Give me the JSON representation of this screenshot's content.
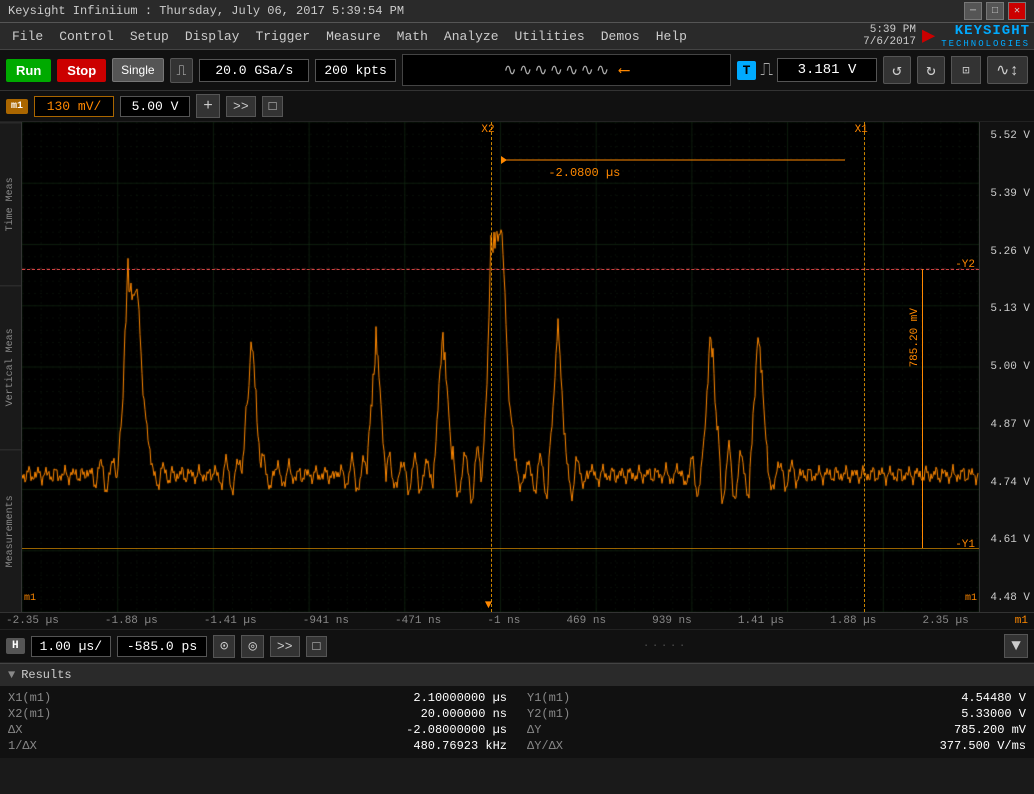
{
  "titleBar": {
    "text": "Keysight Infiniium : Thursday, July 06, 2017  5:39:54 PM",
    "controls": [
      "minimize",
      "restore",
      "close"
    ]
  },
  "logo": {
    "time": "5:39 PM",
    "date": "7/6/2017",
    "brand": "KEYSIGHT",
    "sub": "TECHNOLOGIES"
  },
  "menu": {
    "items": [
      "File",
      "Control",
      "Setup",
      "Display",
      "Trigger",
      "Measure",
      "Math",
      "Analyze",
      "Utilities",
      "Demos",
      "Help"
    ]
  },
  "toolbar": {
    "run_label": "Run",
    "stop_label": "Stop",
    "single_label": "Single",
    "sample_rate": "20.0 GSa/s",
    "mem_depth": "200 kpts",
    "trig_T": "T",
    "trig_value": "3.181 V",
    "wave_symbol": "∿∿∿∿∿∿∿"
  },
  "channel": {
    "badge": "m1",
    "vdiv": "130 mV/",
    "offset": "5.00 V",
    "plus": "+",
    "arrows": ">>",
    "ref": "□"
  },
  "scope": {
    "grid_color": "#1a3a1a",
    "waveform_color": "#ff8800",
    "cursor_color": "#ff8800",
    "x1_pos_pct": 88,
    "x2_pos_pct": 49,
    "y1_level_pct": 87,
    "y2_level_pct": 30,
    "x1_label": "X1",
    "x2_label": "X2",
    "y1_label": "-Y1",
    "y2_label": "-Y2",
    "delta_t_label": "-2.0800 µs",
    "delta_v_label": "785.20 mV"
  },
  "rightScale": {
    "labels": [
      "5.52 V",
      "5.39 V",
      "5.26 V",
      "5.13 V",
      "5.00 V",
      "4.87 V",
      "4.74 V",
      "4.61 V",
      "4.48 V"
    ]
  },
  "timeScale": {
    "labels": [
      "-2.35 µs",
      "-1.88 µs",
      "-1.41 µs",
      "-941 ns",
      "-471 ns",
      "-1 ns",
      "469 ns",
      "939 ns",
      "1.41 µs",
      "1.88 µs",
      "2.35 µs"
    ],
    "right_label": "m1"
  },
  "horizontal": {
    "badge": "H",
    "tdiv": "1.00 µs/",
    "delay": "-585.0 ps",
    "icon1": "⊙",
    "icon2": "◎",
    "arrows": ">>",
    "ref": "□"
  },
  "results": {
    "header": "Results",
    "toggle": "▼",
    "rows_left": [
      {
        "key": "X1(m1)",
        "val": "2.10000000 µs"
      },
      {
        "key": "X2(m1)",
        "val": "20.000000 ns"
      },
      {
        "key": "ΔX",
        "val": "-2.08000000 µs"
      },
      {
        "key": "1/ΔX",
        "val": "480.76923 kHz"
      }
    ],
    "rows_right": [
      {
        "key": "Y1(m1)",
        "val": "4.54480 V"
      },
      {
        "key": "Y2(m1)",
        "val": "5.33000 V"
      },
      {
        "key": "ΔY",
        "val": "785.200 mV"
      },
      {
        "key": "ΔY/ΔX",
        "val": "377.500 V/ms"
      }
    ]
  }
}
